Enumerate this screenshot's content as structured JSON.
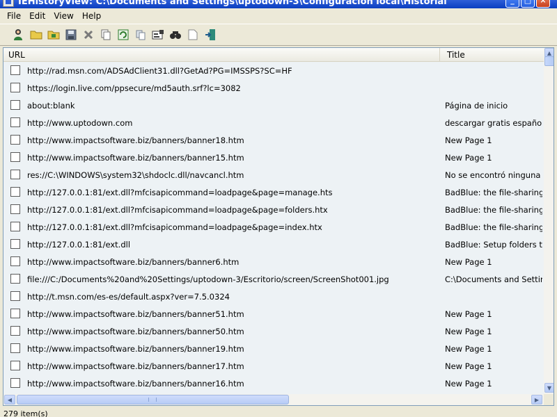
{
  "window": {
    "title": "IEHistoryView:  C:\\Documents and Settings\\uptodown-3\\Configuración local\\Historial"
  },
  "menu": [
    {
      "label": "File"
    },
    {
      "label": "Edit"
    },
    {
      "label": "View"
    },
    {
      "label": "Help"
    }
  ],
  "toolbar": {
    "icons": [
      "users-icon",
      "open-folder-icon",
      "folder-icon",
      "save-icon",
      "delete-icon",
      "copy-icon",
      "refresh-icon",
      "copy-selected-icon",
      "properties-icon",
      "find-icon",
      "blank-page-icon",
      "exit-icon"
    ]
  },
  "list": {
    "columns": {
      "url": "URL",
      "title": "Title"
    },
    "rows": [
      {
        "url": "http://rad.msn.com/ADSAdClient31.dll?GetAd?PG=IMSSPS?SC=HF",
        "title": ""
      },
      {
        "url": "https://login.live.com/ppsecure/md5auth.srf?lc=3082",
        "title": ""
      },
      {
        "url": "about:blank",
        "title": "Página de inicio"
      },
      {
        "url": "http://www.uptodown.com",
        "title": "descargar gratis español ."
      },
      {
        "url": "http://www.impactsoftware.biz/banners/banner18.htm",
        "title": "New Page 1"
      },
      {
        "url": "http://www.impactsoftware.biz/banners/banner15.htm",
        "title": "New Page 1"
      },
      {
        "url": "res://C:\\WINDOWS\\system32\\shdoclc.dll/navcancl.htm",
        "title": "No se encontró ninguna p."
      },
      {
        "url": "http://127.0.0.1:81/ext.dll?mfcisapicommand=loadpage&page=manage.hts",
        "title": "BadBlue: the file-sharing .."
      },
      {
        "url": "http://127.0.0.1:81/ext.dll?mfcisapicommand=loadpage&page=folders.htx",
        "title": "BadBlue: the file-sharing .."
      },
      {
        "url": "http://127.0.0.1:81/ext.dll?mfcisapicommand=loadpage&page=index.htx",
        "title": "BadBlue: the file-sharing .."
      },
      {
        "url": "http://127.0.0.1:81/ext.dll",
        "title": "BadBlue: Setup folders tab"
      },
      {
        "url": "http://www.impactsoftware.biz/banners/banner6.htm",
        "title": "New Page 1"
      },
      {
        "url": "file:///C:/Documents%20and%20Settings/uptodown-3/Escritorio/screen/ScreenShot001.jpg",
        "title": "C:\\Documents and Setting"
      },
      {
        "url": "http://t.msn.com/es-es/default.aspx?ver=7.5.0324",
        "title": ""
      },
      {
        "url": "http://www.impactsoftware.biz/banners/banner51.htm",
        "title": "New Page 1"
      },
      {
        "url": "http://www.impactsoftware.biz/banners/banner50.htm",
        "title": "New Page 1"
      },
      {
        "url": "http://www.impactsoftware.biz/banners/banner19.htm",
        "title": "New Page 1"
      },
      {
        "url": "http://www.impactsoftware.biz/banners/banner17.htm",
        "title": "New Page 1"
      },
      {
        "url": "http://www.impactsoftware.biz/banners/banner16.htm",
        "title": "New Page 1"
      }
    ]
  },
  "status": {
    "text": "279 item(s)"
  },
  "colors": {
    "list_background": "#edf2f5",
    "titlebar": "#0a3ec0",
    "chrome": "#ece9d8"
  }
}
